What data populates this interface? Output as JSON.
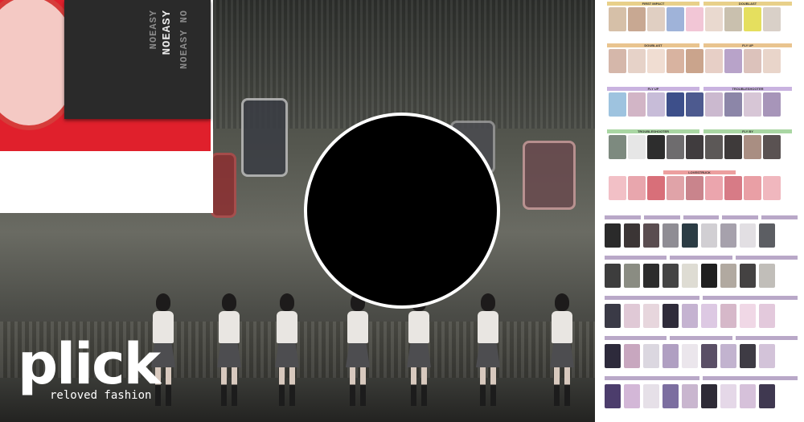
{
  "brand": {
    "logo": "plick",
    "tagline": "reloved fashion"
  },
  "album_text": {
    "main": "NOEASY",
    "faint_1": "NOEASY NO",
    "faint_2": "NOEASY"
  },
  "colors": {
    "album_background": "#e0202c",
    "brand_text": "#ffffff",
    "redaction_circle": "#000000"
  },
  "sheet": {
    "sections": [
      {
        "left_label": "FIRST IMPACT",
        "right_label": "DOUBLAST",
        "header_color": "#e8d08a"
      },
      {
        "left_label": "DOUBLAST",
        "right_label": "FLY UP",
        "header_color": "#e9c48f"
      },
      {
        "left_label": "FLY UP",
        "right_label": "TROUBLESHOOTER",
        "header_color": "#c9b3e0"
      },
      {
        "left_label": "TROUBLESHOOTER",
        "right_label": "FLY BY",
        "header_color": "#a9d6a3"
      },
      {
        "left_label": "",
        "right_label": "LOVESTRUCK",
        "header_color": "#ec9f9f"
      }
    ]
  }
}
